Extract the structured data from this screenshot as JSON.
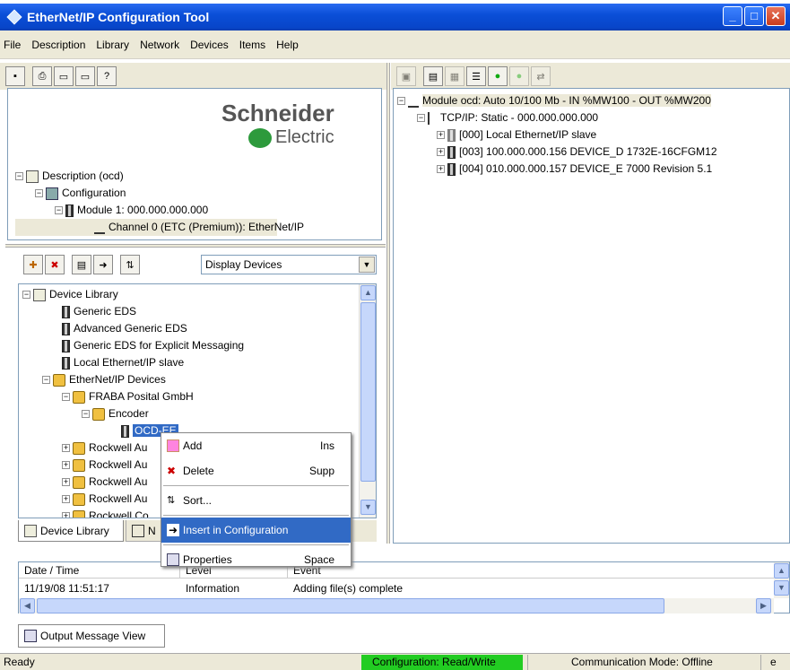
{
  "window": {
    "title": "EtherNet/IP Configuration Tool"
  },
  "menu": [
    "File",
    "Description",
    "Library",
    "Network",
    "Devices",
    "Items",
    "Help"
  ],
  "logo": {
    "line1": "Schneider",
    "line2": "Electric"
  },
  "desc_tree": {
    "root": "Description (ocd)",
    "config": "Configuration",
    "module": "Module 1:  000.000.000.000",
    "channel": "Channel 0 (ETC (Premium)): EtherNet/IP"
  },
  "display_select": {
    "value": "Display Devices"
  },
  "library_tree": {
    "root": "Device Library",
    "items": [
      "Generic EDS",
      "Advanced Generic EDS",
      "Generic EDS for Explicit Messaging",
      "Local Ethernet/IP slave"
    ],
    "ethernet": "EtherNet/IP Devices",
    "fraba": "FRABA Posital GmbH",
    "encoder": "Encoder",
    "ocd": "OCD-EE",
    "rockwell": [
      "Rockwell Au",
      "Rockwell Au",
      "Rockwell Au",
      "Rockwell Au"
    ],
    "rockwell_last": "Rockwell Co"
  },
  "context_menu": {
    "add": "Add",
    "add_sc": "Ins",
    "delete": "Delete",
    "delete_sc": "Supp",
    "sort": "Sort...",
    "insert": "Insert in Configuration",
    "properties": "Properties",
    "properties_sc": "Space"
  },
  "bottom_tabs": {
    "library": "Device Library",
    "network": "N"
  },
  "net_tree": {
    "module": "Module ocd: Auto 10/100 Mb - IN %MW100 - OUT %MW200",
    "tcp": "TCP/IP: Static - 000.000.000.000",
    "d0": "[000] Local Ethernet/IP slave",
    "d3": "[003] 100.000.000.156  DEVICE_D  1732E-16CFGM12",
    "d4": "[004] 010.000.000.157  DEVICE_E  7000 Revision 5.1"
  },
  "log": {
    "headers": [
      "Date / Time",
      "Level",
      "Event"
    ],
    "row": [
      "11/19/08 11:51:17",
      "Information",
      "Adding file(s) complete"
    ]
  },
  "output_tab": "Output Message View",
  "status": {
    "ready": "Ready",
    "config": "Configuration: Read/Write",
    "mode": "Communication Mode:  Offline",
    "extra": "e"
  }
}
